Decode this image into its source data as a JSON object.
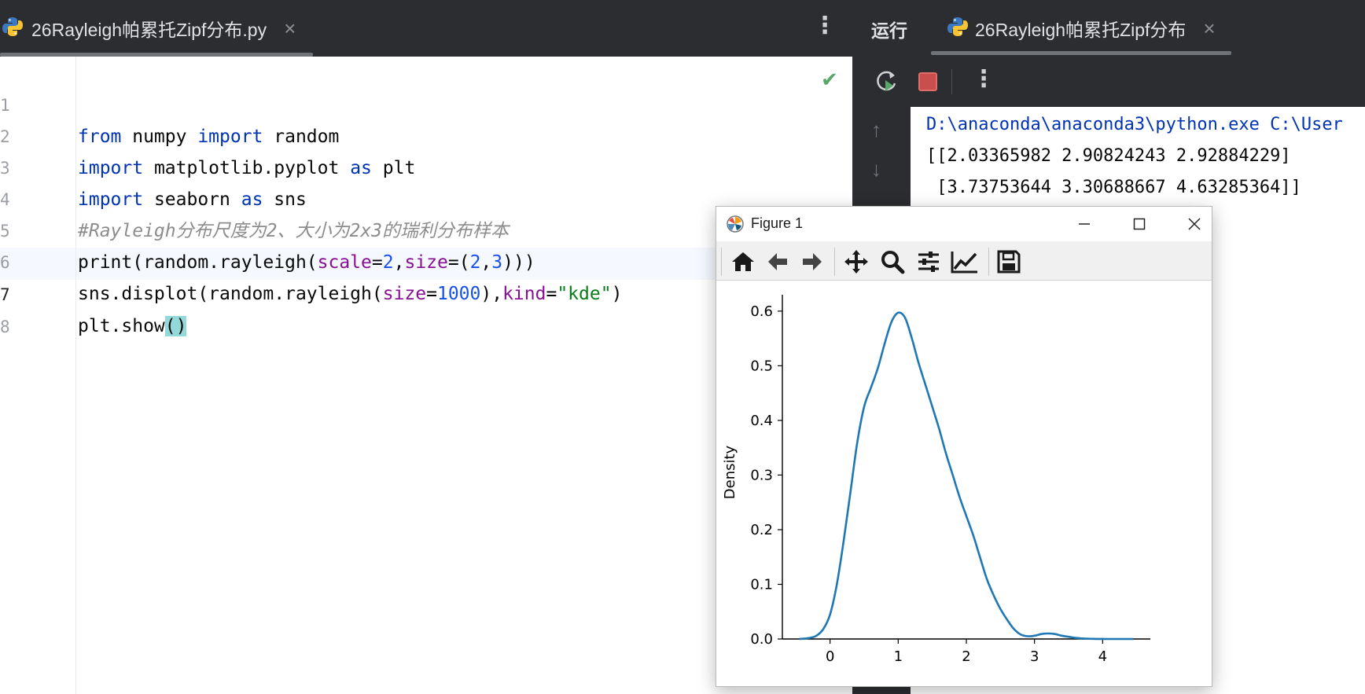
{
  "editor": {
    "tab_label": "26Rayleigh帕累托Zipf分布.py",
    "tab_close": "×",
    "menu": "⋮",
    "inspection_ok": "✔",
    "lines": [
      {
        "num": "1",
        "tokens": [
          [
            "kw",
            "from"
          ],
          [
            "",
            "numpy"
          ],
          [
            "kw",
            "import"
          ],
          [
            "",
            "random"
          ]
        ],
        "sep": [
          " ",
          " ",
          " "
        ]
      },
      {
        "num": "2"
      },
      {
        "num": "3"
      },
      {
        "num": "4"
      },
      {
        "num": "5"
      },
      {
        "num": "6"
      },
      {
        "num": "7"
      },
      {
        "num": "8"
      }
    ],
    "code": {
      "l1": {
        "kw1": "from",
        "t1": " numpy ",
        "kw2": "import",
        "t2": " random"
      },
      "l2": {
        "kw1": "import",
        "t1": " matplotlib.pyplot ",
        "kw2": "as",
        "t2": " plt"
      },
      "l3": {
        "kw1": "import",
        "t1": " seaborn ",
        "kw2": "as",
        "t2": " sns"
      },
      "l4": {
        "comment": "#Rayleigh分布尺度为2、大小为2x3的瑞利分布样本"
      },
      "l5": {
        "fn": "print(random.rayleigh(",
        "p1": "scale",
        "eq1": "=",
        "n1": "2",
        "c1": ",",
        "p2": "size",
        "eq2": "=(",
        "n2": "2",
        "c2": ",",
        "n3": "3",
        "end": ")))"
      },
      "l6": {
        "fn": "sns.displot(random.rayleigh(",
        "p1": "size",
        "eq1": "=",
        "n1": "1000",
        "c1": "),",
        "p2": "kind",
        "eq2": "=",
        "s1": "\"kde\"",
        "end": ")"
      },
      "l7": {
        "fn": "plt.show",
        "paren": "()"
      },
      "l8": {}
    }
  },
  "run": {
    "title": "运行",
    "tab_label": "26Rayleigh帕累托Zipf分布",
    "tab_close": "×",
    "menu": "⋮",
    "arrow_up": "↑",
    "arrow_down": "↓",
    "console": [
      "D:\\anaconda\\anaconda3\\python.exe C:\\User",
      "[[2.03365982 2.90824243 2.92884229]",
      " [3.73753644 3.30688667 4.63285364]]"
    ]
  },
  "figure": {
    "title": "Figure 1",
    "toolbar": [
      "home-icon",
      "back-icon",
      "forward-icon",
      "pan-icon",
      "zoom-icon",
      "configure-icon",
      "edit-axis-icon",
      "save-icon"
    ]
  },
  "colors": {
    "series": "#1f77b4",
    "ide_dark": "#2b2d30",
    "keyword": "#0033b3",
    "param": "#871094",
    "number": "#1750eb",
    "string": "#067d17",
    "comment": "#8c8c8c"
  },
  "chart_data": {
    "type": "line",
    "title": "",
    "xlabel": "",
    "ylabel": "Density",
    "xlim": [
      -0.7,
      4.7
    ],
    "ylim": [
      0,
      0.63
    ],
    "xticks": [
      "0",
      "1",
      "2",
      "3",
      "4"
    ],
    "yticks": [
      "0.0",
      "0.1",
      "0.2",
      "0.3",
      "0.4",
      "0.5",
      "0.6"
    ],
    "grid": false,
    "legend": "none",
    "series": [
      {
        "x": [
          -0.45,
          -0.3,
          -0.2,
          -0.1,
          0.0,
          0.1,
          0.2,
          0.3,
          0.4,
          0.5,
          0.6,
          0.7,
          0.8,
          0.9,
          1.0,
          1.1,
          1.2,
          1.3,
          1.4,
          1.5,
          1.6,
          1.7,
          1.8,
          1.9,
          2.0,
          2.1,
          2.2,
          2.3,
          2.4,
          2.5,
          2.6,
          2.7,
          2.8,
          2.9,
          3.0,
          3.1,
          3.2,
          3.3,
          3.4,
          3.5,
          3.6,
          3.7,
          3.8,
          3.9,
          4.0,
          4.2,
          4.45
        ],
        "y": [
          0.0,
          0.002,
          0.006,
          0.018,
          0.045,
          0.1,
          0.18,
          0.27,
          0.36,
          0.425,
          0.46,
          0.495,
          0.54,
          0.58,
          0.597,
          0.588,
          0.55,
          0.505,
          0.465,
          0.425,
          0.385,
          0.34,
          0.3,
          0.26,
          0.225,
          0.19,
          0.15,
          0.11,
          0.08,
          0.055,
          0.035,
          0.018,
          0.008,
          0.005,
          0.006,
          0.009,
          0.01,
          0.009,
          0.006,
          0.004,
          0.002,
          0.001,
          0.0005,
          0.0002,
          0.0001,
          0.0,
          0.0
        ]
      }
    ]
  }
}
